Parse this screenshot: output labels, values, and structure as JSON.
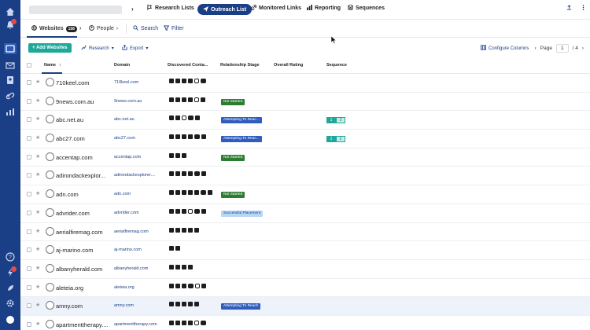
{
  "topbar": {
    "nav": [
      {
        "label": "Research Lists",
        "icon": "flag-icon"
      },
      {
        "label": "Outreach List",
        "icon": "send-icon",
        "active": true
      },
      {
        "label": "Monitored Links",
        "icon": "link-icon"
      },
      {
        "label": "Reporting",
        "icon": "chart-icon"
      },
      {
        "label": "Sequences",
        "icon": "layers-icon"
      }
    ]
  },
  "tabs": {
    "websites_label": "Websites",
    "websites_count": "158",
    "people_label": "People",
    "search_label": "Search",
    "filter_label": "Filter"
  },
  "toolbar": {
    "add_label": "+ Add Websites",
    "research_label": "Research",
    "export_label": "Export",
    "configure_label": "Configure Columns",
    "page_label": "Page",
    "page_current": "1",
    "page_total": "/ 4"
  },
  "table": {
    "headers": {
      "name": "Name",
      "domain": "Domain",
      "contacts": "Discovered Conta...",
      "stage": "Relationship Stage",
      "rating": "Overall Rating",
      "sequence": "Sequence"
    },
    "rows": [
      {
        "name": "710keel.com",
        "domain": "710keel.com",
        "icons": [
          "mail",
          "tiktok",
          "facebook",
          "twitter",
          "instagram",
          "youtube"
        ],
        "stage": "",
        "stage_type": "",
        "seq": []
      },
      {
        "name": "9news.com.au",
        "domain": "9news.com.au",
        "icons": [
          "mail",
          "tiktok",
          "facebook",
          "twitter",
          "instagram",
          "linkedin"
        ],
        "stage": "Not Started",
        "stage_type": "ns",
        "seq": []
      },
      {
        "name": "abc.net.au",
        "domain": "abc.net.au",
        "icons": [
          "facebook",
          "twitter",
          "instagram",
          "youtube",
          "linkedin"
        ],
        "stage": "Attempting To Reac...",
        "stage_type": "atr",
        "seq": [
          "1",
          "2"
        ]
      },
      {
        "name": "abc27.com",
        "domain": "abc27.com",
        "icons": [
          "mail",
          "tiktok",
          "facebook",
          "twitter",
          "youtube",
          "linkedin"
        ],
        "stage": "Attempting To Reac...",
        "stage_type": "atr",
        "seq": [
          "1",
          "2"
        ]
      },
      {
        "name": "accentap.com",
        "domain": "accentap.com",
        "icons": [
          "mail",
          "tiktok",
          "linkedin"
        ],
        "stage": "Not Started",
        "stage_type": "ns",
        "seq": []
      },
      {
        "name": "adirondackexplor...",
        "domain": "adirondackexplorer....",
        "icons": [
          "mail",
          "tiktok",
          "facebook",
          "twitter",
          "youtube",
          "linkedin"
        ],
        "stage": "",
        "stage_type": "",
        "seq": []
      },
      {
        "name": "adn.com",
        "domain": "adn.com",
        "icons": [
          "mail",
          "tiktok",
          "facebook",
          "twitter",
          "pinterest",
          "youtube",
          "linkedin"
        ],
        "stage": "Not Started",
        "stage_type": "ns",
        "seq": []
      },
      {
        "name": "advrider.com",
        "domain": "advrider.com",
        "icons": [
          "mail",
          "facebook",
          "pinterest",
          "instagram",
          "youtube",
          "linkedin"
        ],
        "stage": "Successful Placement",
        "stage_type": "sp",
        "seq": []
      },
      {
        "name": "aerialfiremag.com",
        "domain": "aerialfiremag.com",
        "icons": [
          "mail",
          "tiktok",
          "facebook",
          "twitter",
          "linkedin"
        ],
        "stage": "",
        "stage_type": "",
        "seq": []
      },
      {
        "name": "aj-marino.com",
        "domain": "aj-marino.com",
        "icons": [
          "tiktok",
          "linkedin"
        ],
        "stage": "",
        "stage_type": "",
        "seq": []
      },
      {
        "name": "albanyherald.com",
        "domain": "albanyherald.com",
        "icons": [
          "mail",
          "facebook",
          "twitter",
          "linkedin"
        ],
        "stage": "",
        "stage_type": "",
        "seq": []
      },
      {
        "name": "aleteia.org",
        "domain": "aleteia.org",
        "icons": [
          "mail",
          "facebook",
          "twitter",
          "youtube",
          "instagram",
          "linkedin"
        ],
        "stage": "",
        "stage_type": "",
        "seq": []
      },
      {
        "name": "amny.com",
        "domain": "amny.com",
        "icons": [
          "mail",
          "twitter",
          "facebook",
          "twitter",
          "linkedin"
        ],
        "stage": "Attempting To Reach",
        "stage_type": "atr",
        "seq": [],
        "highlight": true
      },
      {
        "name": "apartmenttherapy....",
        "domain": "apartmenttherapy.com",
        "icons": [
          "mail",
          "tiktok",
          "facebook",
          "twitter",
          "instagram",
          "youtube"
        ],
        "stage": "",
        "stage_type": "",
        "seq": []
      }
    ]
  }
}
